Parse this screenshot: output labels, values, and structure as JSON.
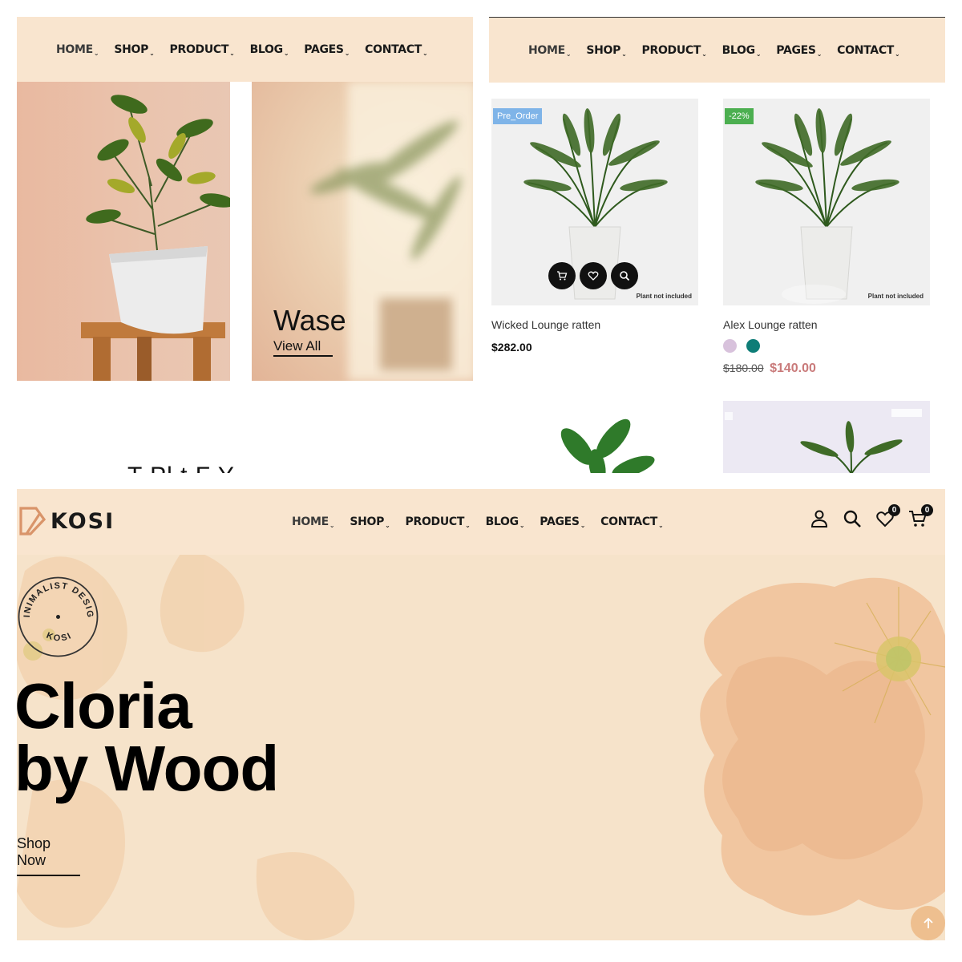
{
  "nav": {
    "items": [
      "HOME",
      "SHOP",
      "PRODUCT",
      "BLOG",
      "PAGES",
      "CONTACT"
    ]
  },
  "panel_a": {
    "banner_title": "Wase",
    "banner_link": "View All",
    "cut_heading": "T   Pl  t  F  Y"
  },
  "panel_b": {
    "products": [
      {
        "badge": "Pre_Order",
        "badge_color": "#7fb4e8",
        "note": "Plant not included",
        "name": "Wicked Lounge ratten",
        "price": "$282.00"
      },
      {
        "badge": "-22%",
        "badge_color": "#4caf50",
        "note": "Plant not included",
        "name": "Alex Lounge ratten",
        "old_price": "$180.00",
        "sale_price": "$140.00",
        "swatches": [
          "#d8c2dc",
          "#0e7d77"
        ]
      }
    ]
  },
  "panel_c": {
    "logo": "KOSI",
    "wishlist_count": "0",
    "cart_count": "0",
    "stamp_top": "MINIMALIST DESIGN",
    "stamp_bottom": "KOSI",
    "hero_line1": "Cloria",
    "hero_line2": "by Wood",
    "cta": "Shop Now"
  },
  "colors": {
    "nav_bg": "#f9e5cf",
    "hero_bg": "#f6e3ca",
    "accent": "#c97a7a",
    "scroll_top_bg": "#eebf8f"
  }
}
